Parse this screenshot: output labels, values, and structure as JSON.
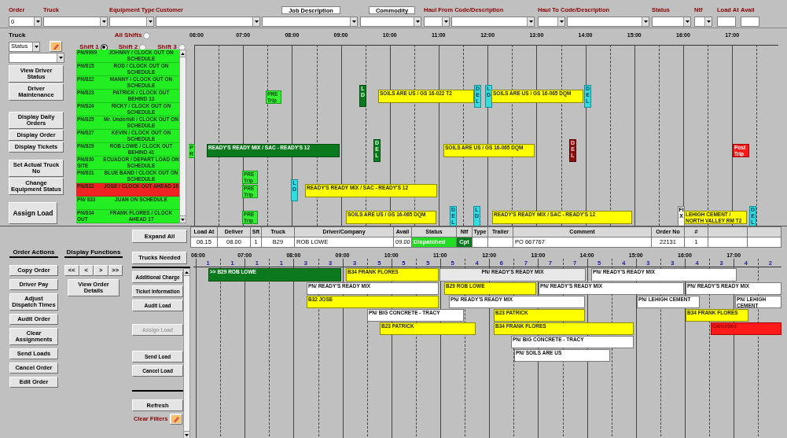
{
  "filters": [
    {
      "label": "Order",
      "value": "0",
      "kind": "select"
    },
    {
      "label": "Truck",
      "kind": "select"
    },
    {
      "label": "Equipment Type",
      "kind": "select"
    },
    {
      "label": "Customer",
      "kind": "select"
    },
    {
      "label": "Job Description",
      "kind": "tab_select"
    },
    {
      "label": "Commodity",
      "kind": "tab_select"
    },
    {
      "label": "Haul From Code/Description",
      "kind": "pair_select"
    },
    {
      "label": "Haul To Code/Description",
      "kind": "pair_select"
    },
    {
      "label": "Status",
      "kind": "select"
    },
    {
      "label": "Ntf",
      "kind": "select"
    },
    {
      "label": "Load At",
      "kind": "input"
    },
    {
      "label": "Avail",
      "kind": "input"
    }
  ],
  "truck_panel": {
    "label": "Truck",
    "status_select": "Status",
    "buttons": [
      "View Driver Status",
      "Driver Maintenance",
      "Display Daily Orders",
      "Display Order",
      "Display Tickets",
      "Set Actual Truck No",
      "Change Equipment Status"
    ],
    "assign_button": "Assign Load"
  },
  "shifts": [
    {
      "label": "All Shifts",
      "selected": false
    },
    {
      "label": "Shift 1",
      "selected": true
    },
    {
      "label": "Shift 2",
      "selected": false
    },
    {
      "label": "Shift 3",
      "selected": false
    }
  ],
  "drivers": [
    {
      "unit": "PN/9999",
      "name": "JOHNNY / CLOCK OUT",
      "status": "ON SCHEDULE",
      "color": "#22ee22"
    },
    {
      "unit": "PN/815",
      "name": "ROD / CLOCK OUT",
      "status": "ON SCHEDULE",
      "color": "#22ee22"
    },
    {
      "unit": "PN/822",
      "name": "MANNY / CLOCK OUT",
      "status": "ON SCHEDULE",
      "color": "#22ee22"
    },
    {
      "unit": "PN/823",
      "name": "PATRICK / CLOCK OUT",
      "status": "BEHIND   13",
      "color": "#22ee22"
    },
    {
      "unit": "PN/824",
      "name": "RICKY / CLOCK OUT",
      "status": "ON SCHEDULE",
      "color": "#22ee22"
    },
    {
      "unit": "PN/825",
      "name": "Mr. Underhill / CLOCK OUT",
      "status": "ON SCHEDULE",
      "color": "#22ee22"
    },
    {
      "unit": "PN/827",
      "name": "KEVIN / CLOCK OUT",
      "status": "ON SCHEDULE",
      "color": "#22ee22"
    },
    {
      "unit": "PN/829",
      "name": "ROB LOWE / CLOCK OUT",
      "status": "BEHIND   41",
      "color": "#22ee22"
    },
    {
      "unit": "PN/830 SITE",
      "name": "ECUADOR / DEPART LOAD",
      "status": "ON SCHEDULE",
      "color": "#22ee22"
    },
    {
      "unit": "PN/831",
      "name": "BLUE BAND / CLOCK OUT",
      "status": "ON SCHEDULE",
      "color": "#22ee22"
    },
    {
      "unit": "PN/832",
      "name": "JOSE / CLOCK OUT",
      "status": "AHEAD   16",
      "color": "#ee2222"
    },
    {
      "unit": "PN/ 833",
      "name": "JUAN",
      "status": "ON SCHEDULE",
      "color": "#22ee22"
    },
    {
      "unit": "PN/834 OUT",
      "name": "FRANK FLORES / CLOCK",
      "status": "AHEAD   17",
      "color": "#22ee22"
    }
  ],
  "top_schedule": {
    "times": [
      "06:00",
      "07:00",
      "08:00",
      "09:00",
      "10:00",
      "11:00",
      "12:00",
      "13:00",
      "14:00",
      "15:00",
      "16:00",
      "17:00"
    ],
    "bars": [
      {
        "text": "PRE Trip",
        "kind": "pretrip"
      },
      {
        "text": "LD",
        "kind": "done"
      },
      {
        "text": "SOILS ARE US / GS 16-022 T2",
        "kind": "scheduled"
      },
      {
        "text": "DEL",
        "kind": "stop"
      },
      {
        "text": "LD",
        "kind": "stop"
      },
      {
        "text": "SOILS ARE US / GS 16-065 DQM",
        "kind": "scheduled"
      },
      {
        "text": "DEL",
        "kind": "stop"
      },
      {
        "text": "PR",
        "kind": "pretrip"
      },
      {
        "text": "READY'S READY MIX / SAC - READY'S 12",
        "kind": "active"
      },
      {
        "text": "DEL",
        "kind": "done"
      },
      {
        "text": "SOILS ARE US / GS 16-065 DQM",
        "kind": "scheduled"
      },
      {
        "text": "DEL",
        "kind": "late"
      },
      {
        "text": "Post Trip",
        "kind": "posttrip"
      },
      {
        "text": "PRE Trip",
        "kind": "pretrip"
      },
      {
        "text": "PRE Trip",
        "kind": "pretrip"
      },
      {
        "text": "LD",
        "kind": "stop"
      },
      {
        "text": "READY'S READY MIX / SAC - READY'S 12",
        "kind": "scheduled"
      },
      {
        "text": "PRE Trip",
        "kind": "pretrip"
      },
      {
        "text": "SOILS ARE US / GS 16-065 DQM",
        "kind": "scheduled"
      },
      {
        "text": "DEL",
        "kind": "stop"
      },
      {
        "text": "LD",
        "kind": "stop"
      },
      {
        "text": "READY'S READY MIX / SAC - READY'S 12",
        "kind": "scheduled"
      },
      {
        "text": "FIX",
        "kind": "fix"
      },
      {
        "text": "LEHIGH CEMENT / NORTH VALLEY RM T2",
        "kind": "scheduled"
      },
      {
        "text": "DEL",
        "kind": "stop"
      }
    ]
  },
  "expand_button": "Expand All",
  "order_table": {
    "columns": [
      "Load At",
      "Deliver",
      "Sft",
      "Truck",
      "Driver/Company",
      "Avail",
      "Status",
      "Ntf",
      "Type",
      "Trailer",
      "Comment",
      "Order No",
      "#"
    ],
    "rows": [
      {
        "cells": [
          {
            "value": "06.15"
          },
          {
            "value": "08.00"
          },
          {
            "value": "1"
          },
          {
            "value": "B29"
          },
          {
            "value": "ROB LOWE"
          },
          {
            "value": "09.00"
          },
          {
            "value": "Dispatched",
            "color": "#22dd22"
          },
          {
            "value": "Cpt",
            "color": "#0b7a1e"
          },
          {},
          {},
          {
            "value": "PO 667767"
          },
          {
            "value": "22131"
          },
          {
            "value": "1"
          }
        ]
      }
    ]
  },
  "trucks_needed_button": "Trucks Needed",
  "order_actions": {
    "title": "Order Actions",
    "buttons": [
      "Copy Order",
      "Driver Pay",
      "Adjust Dispatch Times",
      "Audit Order",
      "Clear Assignments",
      "Send Loads",
      "Cancel Order",
      "Edit Order"
    ]
  },
  "display_functions": {
    "title": "Display Functions",
    "nav": [
      "<<",
      "<",
      ">",
      ">>"
    ],
    "buttons": [
      "View Order Details"
    ]
  },
  "load_actions": [
    {
      "label": "Additional Charge",
      "disabled": false
    },
    {
      "label": "Ticket Information",
      "disabled": false
    },
    {
      "label": "Audit Load",
      "disabled": false
    },
    {
      "label": "Assign Load",
      "disabled": true
    },
    {
      "label": "Send Load",
      "disabled": false
    },
    {
      "label": "Cancel Load",
      "disabled": false
    }
  ],
  "refresh_button": "Refresh",
  "clear_filters": "Clear Filters",
  "load_schedule": {
    "times": [
      "06:00",
      "07:00",
      "08:00",
      "09:00",
      "10:00",
      "11:00",
      "12:00",
      "13:00",
      "14:00",
      "15:00",
      "16:00",
      "17:00"
    ],
    "trucks_needed": [
      "1",
      "1",
      "1",
      "1",
      "3",
      "3",
      "3",
      "5",
      "5",
      "5",
      "5",
      "4",
      "6",
      "7",
      "7",
      "7",
      "5",
      "4",
      "3",
      "3",
      "4",
      "3",
      "4",
      "2"
    ],
    "bars": [
      {
        "text": ">> B29 ROB LOWE",
        "kind": "active"
      },
      {
        "text": "B34 FRANK FLORES",
        "kind": "scheduled"
      },
      {
        "text": "PN/ READY'S READY MIX",
        "kind": "highlight"
      },
      {
        "text": "PN/ READY'S READY MIX",
        "kind": "open"
      },
      {
        "text": "PN/ READY'S READY MIX",
        "kind": "open"
      },
      {
        "text": "B29 ROB LOWE",
        "kind": "scheduled"
      },
      {
        "text": "PN/ READY'S READY MIX",
        "kind": "open"
      },
      {
        "text": "PN/ READY'S READY MIX",
        "kind": "open"
      },
      {
        "text": "B32 JOSE",
        "kind": "scheduled"
      },
      {
        "text": "PN/ READY'S READY MIX",
        "kind": "open"
      },
      {
        "text": "PN/ LEHIGH CEMENT",
        "kind": "open"
      },
      {
        "text": "PN/ LEHIGH CEMENT",
        "kind": "open"
      },
      {
        "text": "PN/ BIG  CONCRETE - TRACY",
        "kind": "open"
      },
      {
        "text": "B23 PATRICK",
        "kind": "scheduled"
      },
      {
        "text": "B34 FRANK FLORES",
        "kind": "scheduled"
      },
      {
        "text": "B23 PATRICK",
        "kind": "scheduled"
      },
      {
        "text": "B34 FRANK FLORES",
        "kind": "scheduled"
      },
      {
        "text": "Cancelled",
        "kind": "cancelled"
      },
      {
        "text": "PN/ BIG  CONCRETE - TRACY",
        "kind": "open"
      },
      {
        "text": "PN/ SOILS ARE US",
        "kind": "open"
      }
    ]
  }
}
